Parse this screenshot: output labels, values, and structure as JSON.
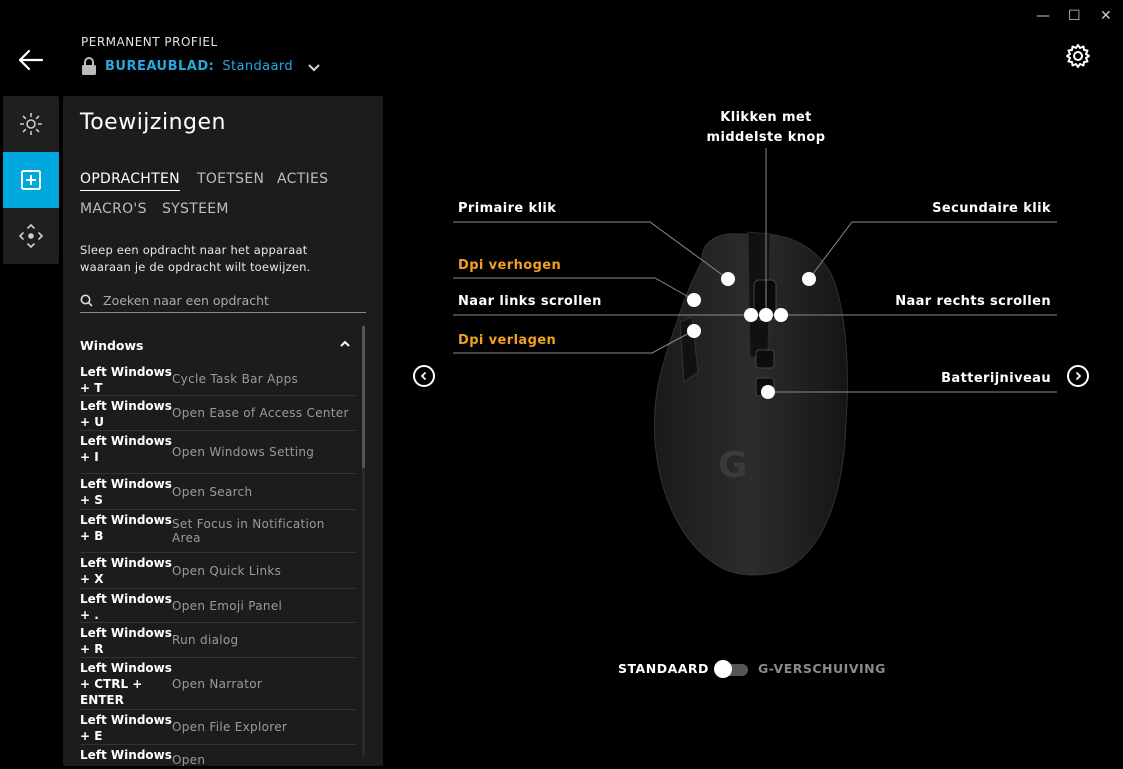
{
  "window": {
    "minimize": "—",
    "maximize": "☐",
    "close": "✕"
  },
  "header": {
    "kicker": "PERMANENT PROFIEL",
    "profile_label": "BUREAUBLAD:",
    "profile_value": "Standaard"
  },
  "panel": {
    "title": "Toewijzingen",
    "tabs": [
      "OPDRACHTEN",
      "TOETSEN",
      "ACTIES",
      "MACRO'S",
      "SYSTEEM"
    ],
    "help": "Sleep een opdracht naar het apparaat waaraan je de opdracht wilt toewijzen.",
    "search_placeholder": "Zoeken naar een opdracht",
    "category": "Windows",
    "items": [
      {
        "key": "Left Windows + T",
        "desc": "Cycle Task Bar Apps"
      },
      {
        "key": "Left Windows + U",
        "desc": "Open Ease of Access Center"
      },
      {
        "key": "Left Windows + I",
        "desc": "Open Windows Setting"
      },
      {
        "key": "Left Windows + S",
        "desc": "Open Search"
      },
      {
        "key": "Left Windows + B",
        "desc": "Set Focus in Notification Area"
      },
      {
        "key": "Left Windows + X",
        "desc": "Open Quick Links"
      },
      {
        "key": "Left Windows + .",
        "desc": "Open Emoji Panel"
      },
      {
        "key": "Left Windows + R",
        "desc": "Run dialog"
      },
      {
        "key": "Left Windows + CTRL + ENTER",
        "desc": "Open Narrator"
      },
      {
        "key": "Left Windows + E",
        "desc": "Open File Explorer"
      },
      {
        "key": "Left Windows",
        "desc": "Open"
      }
    ]
  },
  "labels": {
    "middle": "Klikken met middelste knop",
    "primary": "Primaire klik",
    "secondary": "Secundaire klik",
    "dpi_up": "Dpi verhogen",
    "scroll_left": "Naar links scrollen",
    "scroll_right": "Naar rechts scrollen",
    "dpi_down": "Dpi verlagen",
    "battery": "Batterijniveau"
  },
  "mode": {
    "standard": "STANDAARD",
    "gshift": "G-VERSCHUIVING",
    "gshift_on": false
  },
  "colors": {
    "accent": "#00a8e0",
    "profile": "#28a8e0",
    "warning": "#f0a020"
  }
}
